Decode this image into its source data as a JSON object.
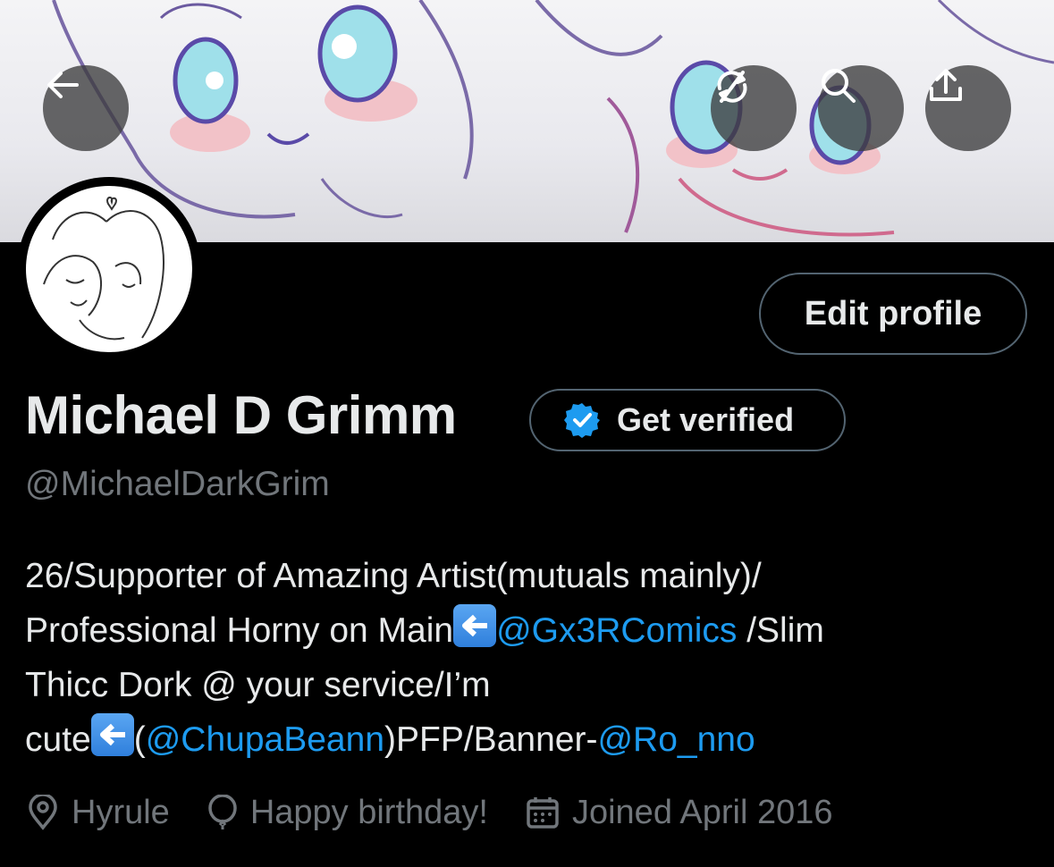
{
  "header": {
    "back_icon": "arrow-left-icon",
    "actions": [
      {
        "name": "sync-icon"
      },
      {
        "name": "search-icon"
      },
      {
        "name": "share-icon"
      }
    ]
  },
  "profile": {
    "edit_label": "Edit profile",
    "name": "Michael D Grimm",
    "verify_label": "Get verified",
    "handle": "@MichaelDarkGrim",
    "bio": {
      "line1": "26/Supporter of Amazing Artist(mutuals mainly)/",
      "line2_a": "Professional Horny on Main",
      "line2_link": "@Gx3RComics",
      "line2_b": " /Slim",
      "line3": "Thicc Dork @ your service/I’m",
      "line4_a": "cute",
      "line4_b": "(",
      "line4_link1": "@ChupaBeann",
      "line4_c": ")PFP/Banner-",
      "line4_link2": "@Ro_nno"
    },
    "meta": {
      "location": "Hyrule",
      "birthday": "Happy birthday!",
      "joined": "Joined April 2016"
    }
  },
  "colors": {
    "link": "#1d9bf0",
    "secondary_text": "#71767b",
    "verified_badge": "#1d9bf0",
    "background": "#000000"
  }
}
